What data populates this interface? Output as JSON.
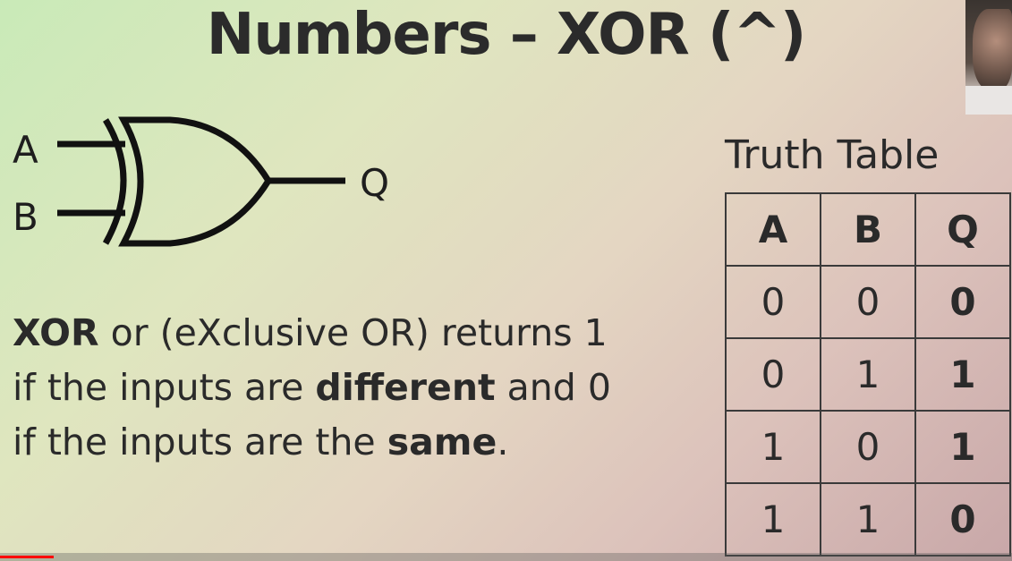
{
  "slide": {
    "title": "Numbers – XOR (^)"
  },
  "gate": {
    "input_a": "A",
    "input_b": "B",
    "output": "Q"
  },
  "description": {
    "line1_bold": "XOR",
    "line1_rest": " or (eXclusive OR) returns 1",
    "line2_pre": "if the inputs are ",
    "line2_bold": "different",
    "line2_post": " and 0",
    "line3_pre": "if the inputs are the ",
    "line3_bold": "same",
    "line3_post": "."
  },
  "truth_table": {
    "title": "Truth Table",
    "headers": [
      "A",
      "B",
      "Q"
    ],
    "rows": [
      [
        "0",
        "0",
        "0"
      ],
      [
        "0",
        "1",
        "1"
      ],
      [
        "1",
        "0",
        "1"
      ],
      [
        "1",
        "1",
        "0"
      ]
    ]
  },
  "video": {
    "progress_fraction": 0.053,
    "played_color": "#ff0000"
  },
  "colors": {
    "text": "#2b2b2b",
    "bg_start": "#c9eab8",
    "bg_end": "#c8a7a8"
  }
}
